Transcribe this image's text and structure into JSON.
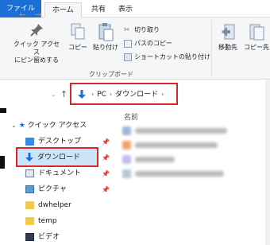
{
  "ribbon_tabs": {
    "file": "ファイル",
    "home": "ホーム",
    "share": "共有",
    "view": "表示"
  },
  "ribbon": {
    "pin_label_1": "クイック アクセス",
    "pin_label_2": "にピン留めする",
    "copy": "コピー",
    "paste": "貼り付け",
    "cut": "切り取り",
    "copy_path": "パスのコピー",
    "paste_shortcut": "ショートカットの貼り付け",
    "clipboard_group": "クリップボード",
    "move_to": "移動先",
    "copy_to": "コピー先"
  },
  "address": {
    "pc": "PC",
    "downloads": "ダウンロード"
  },
  "nav": {
    "quick_access": "クイック アクセス",
    "items": [
      {
        "label": "デスクトップ",
        "icon": "desktop-folder-icon"
      },
      {
        "label": "ダウンロード",
        "icon": "download-arrow-icon"
      },
      {
        "label": "ドキュメント",
        "icon": "document-folder-icon"
      },
      {
        "label": "ピクチャ",
        "icon": "pictures-folder-icon"
      },
      {
        "label": "dwhelper",
        "icon": "folder-icon"
      },
      {
        "label": "temp",
        "icon": "folder-icon"
      },
      {
        "label": "ビデオ",
        "icon": "video-folder-icon"
      }
    ]
  },
  "content": {
    "name_header": "名前"
  },
  "colors": {
    "accent": "#1c6fd6",
    "highlight_border": "#d62828",
    "selected_bg": "#cce4f7"
  }
}
